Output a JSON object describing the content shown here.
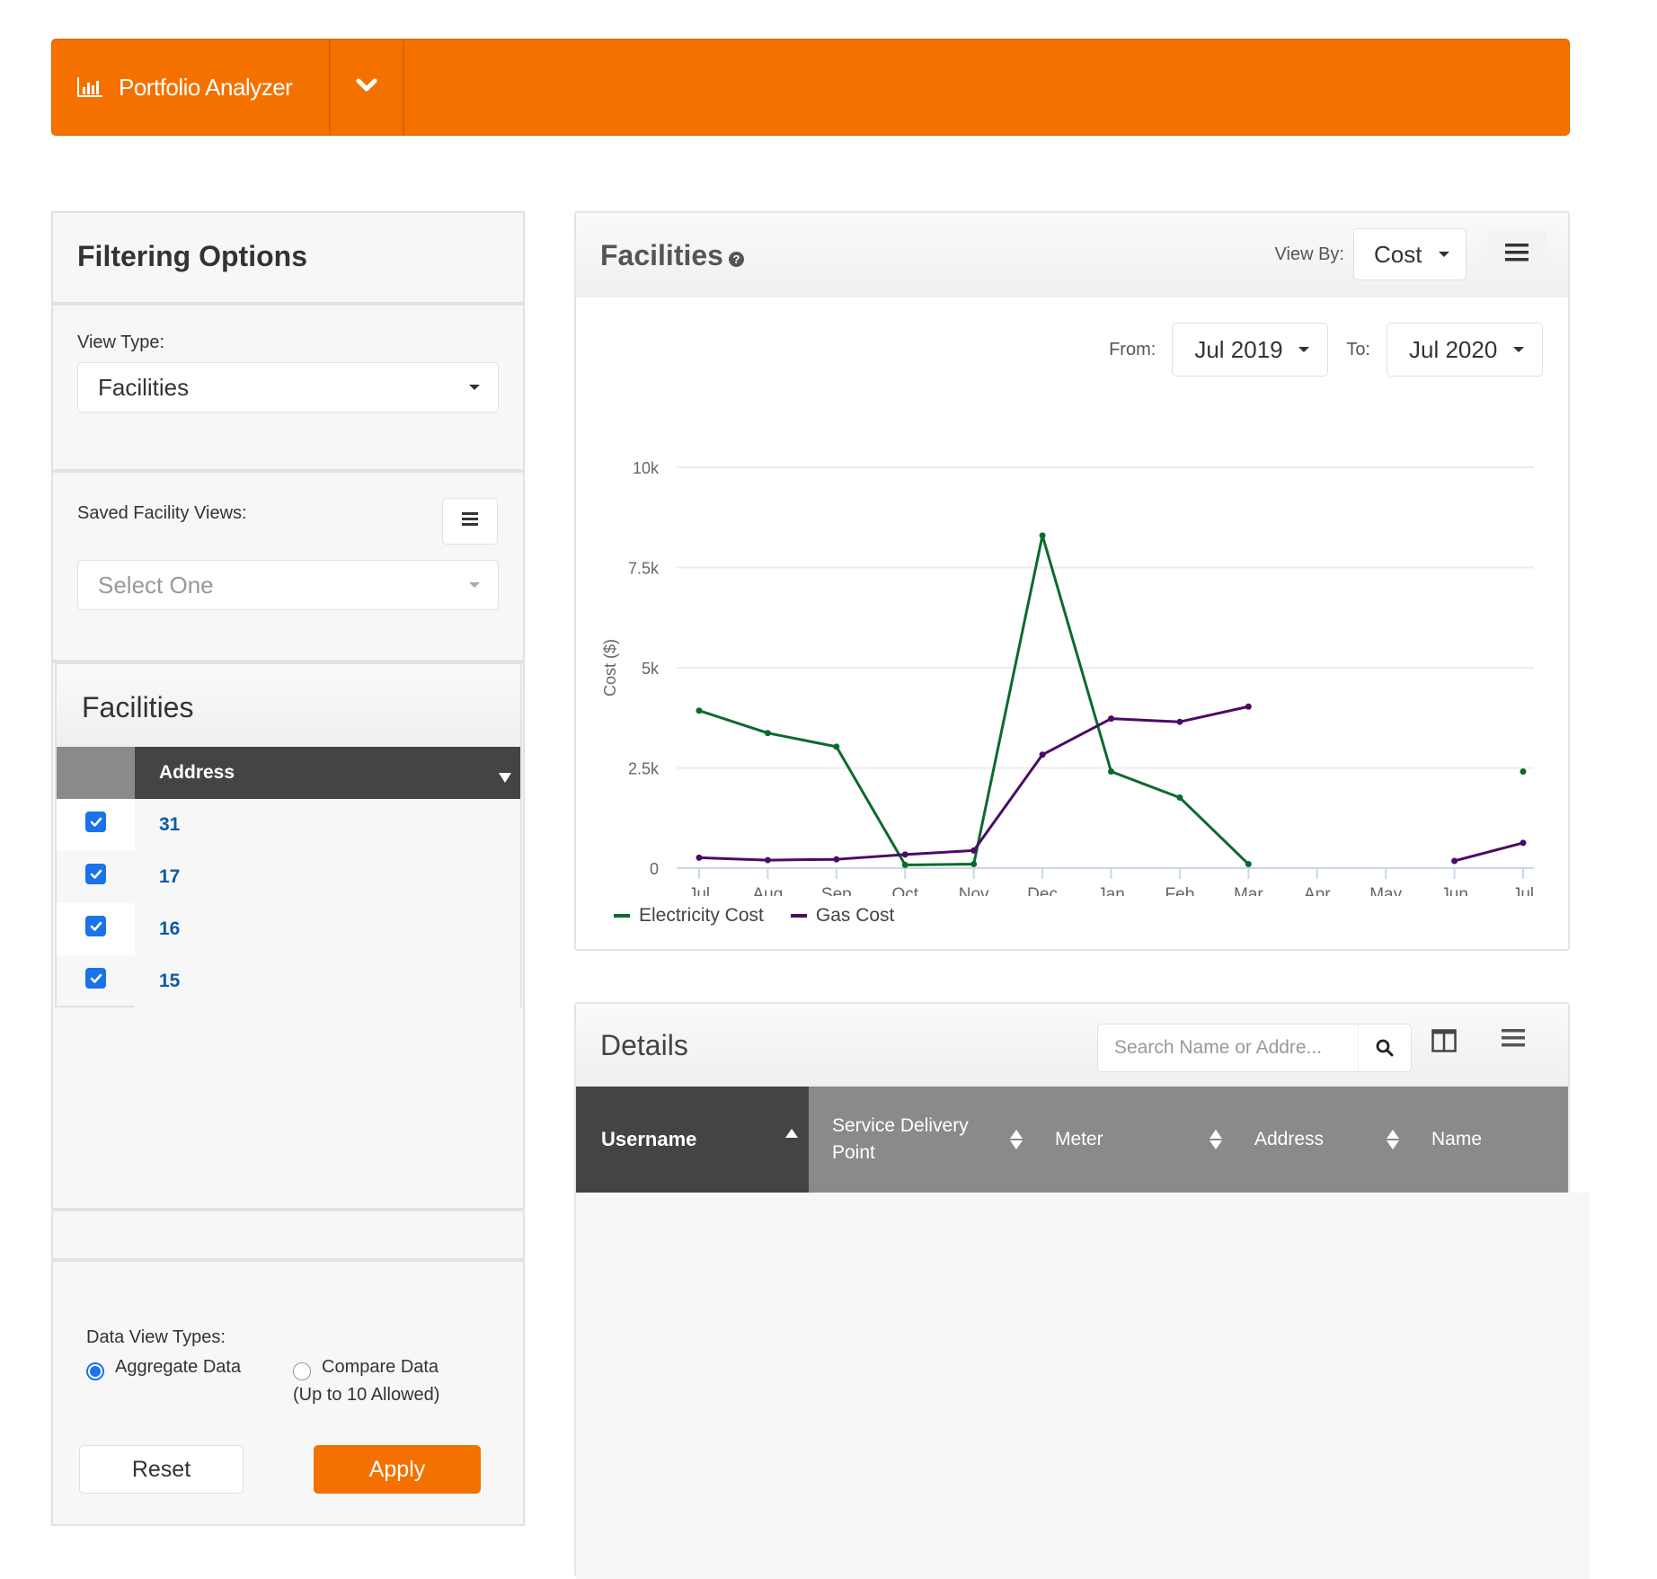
{
  "app": {
    "title": "Portfolio Analyzer",
    "brand_icon": "bar-chart-icon",
    "toggle_icon": "chevron-down-icon"
  },
  "filters": {
    "title": "Filtering Options",
    "view_type": {
      "label": "View Type:",
      "value": "Facilities"
    },
    "saved_views": {
      "label": "Saved Facility Views:",
      "placeholder": "Select One",
      "menu_icon": "hamburger-icon"
    },
    "facilities": {
      "title": "Facilities",
      "column": "Address",
      "rows": [
        {
          "checked": true,
          "address": "31"
        },
        {
          "checked": true,
          "address": "17"
        },
        {
          "checked": true,
          "address": "16"
        },
        {
          "checked": true,
          "address": "15"
        }
      ]
    },
    "data_view_types": {
      "label": "Data View Types:",
      "options": [
        {
          "label": "Aggregate Data",
          "sublabel": "",
          "selected": true
        },
        {
          "label": "Compare Data",
          "sublabel": "(Up to 10 Allowed)",
          "selected": false
        }
      ]
    },
    "reset_label": "Reset",
    "apply_label": "Apply"
  },
  "chart_panel": {
    "title": "Facilities",
    "help_icon": "question-circle-icon",
    "view_by": {
      "label": "View By:",
      "value": "Cost"
    },
    "from": {
      "label": "From:",
      "value": "Jul 2019"
    },
    "to": {
      "label": "To:",
      "value": "Jul 2020"
    }
  },
  "chart_data": {
    "type": "line",
    "title": "",
    "xlabel": "",
    "ylabel": "Cost ($)",
    "categories": [
      "Jul",
      "Aug",
      "Sep",
      "Oct",
      "Nov",
      "Dec",
      "Jan",
      "Feb",
      "Mar",
      "Apr",
      "May",
      "Jun",
      "Jul"
    ],
    "ylim": [
      0,
      10000
    ],
    "yticks": [
      0,
      2500,
      5000,
      7500,
      10000
    ],
    "ytick_labels": [
      "0",
      "2.5k",
      "5k",
      "7.5k",
      "10k"
    ],
    "grid": true,
    "legend": "bottom-left",
    "series": [
      {
        "name": "Electricity Cost",
        "color": "#0b6a2e",
        "values": [
          3930,
          3370,
          3030,
          80,
          100,
          8300,
          2410,
          1760,
          100,
          null,
          null,
          null,
          2410
        ]
      },
      {
        "name": "Gas Cost",
        "color": "#4b0b66",
        "values": [
          260,
          200,
          220,
          340,
          440,
          2830,
          3730,
          3650,
          4030,
          null,
          null,
          180,
          630
        ]
      }
    ]
  },
  "details": {
    "title": "Details",
    "search_placeholder": "Search Name or Addre...",
    "columns": [
      {
        "label": "Username",
        "sort": "asc"
      },
      {
        "label": "Service Delivery Point",
        "sort": "both"
      },
      {
        "label": "Meter",
        "sort": "both"
      },
      {
        "label": "Address",
        "sort": "both"
      },
      {
        "label": "Name",
        "sort": "none"
      }
    ]
  },
  "colors": {
    "accent": "#f47100",
    "header_dark": "#444444",
    "header_grey": "#8a8a8a",
    "link_blue": "#0e5aa7"
  }
}
